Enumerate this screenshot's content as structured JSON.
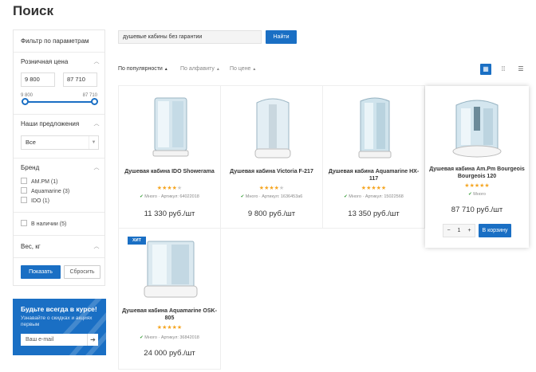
{
  "page": {
    "title": "Поиск"
  },
  "filter": {
    "title": "Фильтр по параметрам",
    "price": {
      "label": "Розничная цена",
      "min_value": "9 800",
      "max_value": "87 710",
      "range_min_label": "9 800",
      "range_max_label": "87 710"
    },
    "offers": {
      "label": "Наши предложения",
      "selected": "Все"
    },
    "brand": {
      "label": "Бренд",
      "options": [
        {
          "label": "AM.PM (1)"
        },
        {
          "label": "Aquamarine (3)"
        },
        {
          "label": "IDO (1)"
        }
      ]
    },
    "in_stock": "В наличии (5)",
    "weight": {
      "label": "Вес, кг"
    },
    "show_button": "Показать",
    "reset_button": "Сбросить"
  },
  "subscribe": {
    "title": "Будьте всегда в курсе!",
    "subtitle": "Узнавайте о скидках и акциях первым",
    "email_placeholder": "Ваш e-mail"
  },
  "search": {
    "query": "душевые кабины без гарантии",
    "button": "Найти"
  },
  "sort": {
    "options": [
      "По популярности",
      "По алфавиту",
      "По цене"
    ],
    "active": "По популярности"
  },
  "view_modes": [
    "grid-icon",
    "tile-icon",
    "list-icon"
  ],
  "products": [
    {
      "name": "Душевая кабина IDO Showerama",
      "rating": 4,
      "stock": "Много",
      "sku": "Артикул: 64022018",
      "price": "11 330 руб./шт"
    },
    {
      "name": "Душевая кабина Victoria F-217",
      "rating": 4,
      "stock": "Много",
      "sku": "Артикул: 1636453a6",
      "price": "9 800 руб./шт"
    },
    {
      "name": "Душевая кабина Aquamarine HX-117",
      "rating": 5,
      "stock": "Много",
      "sku": "Артикул: 15022568",
      "price": "13 350 руб./шт"
    },
    {
      "name": "Душевая кабина Am.Pm Bourgeois Bourgeois 120",
      "rating": 5,
      "stock": "Много",
      "sku": "",
      "price": "87 710 руб./шт",
      "qty": "1",
      "cart_button": "В корзину"
    },
    {
      "name": "Душевая кабина Aquamarine OSK-805",
      "rating": 5,
      "stock": "Много",
      "sku": "Артикул: 36842018",
      "price": "24 000 руб./шт",
      "badge": "ХИТ"
    }
  ],
  "colors": {
    "accent": "#1a6fc4",
    "star": "#f5a623",
    "in_stock": "#3a9e3a"
  }
}
